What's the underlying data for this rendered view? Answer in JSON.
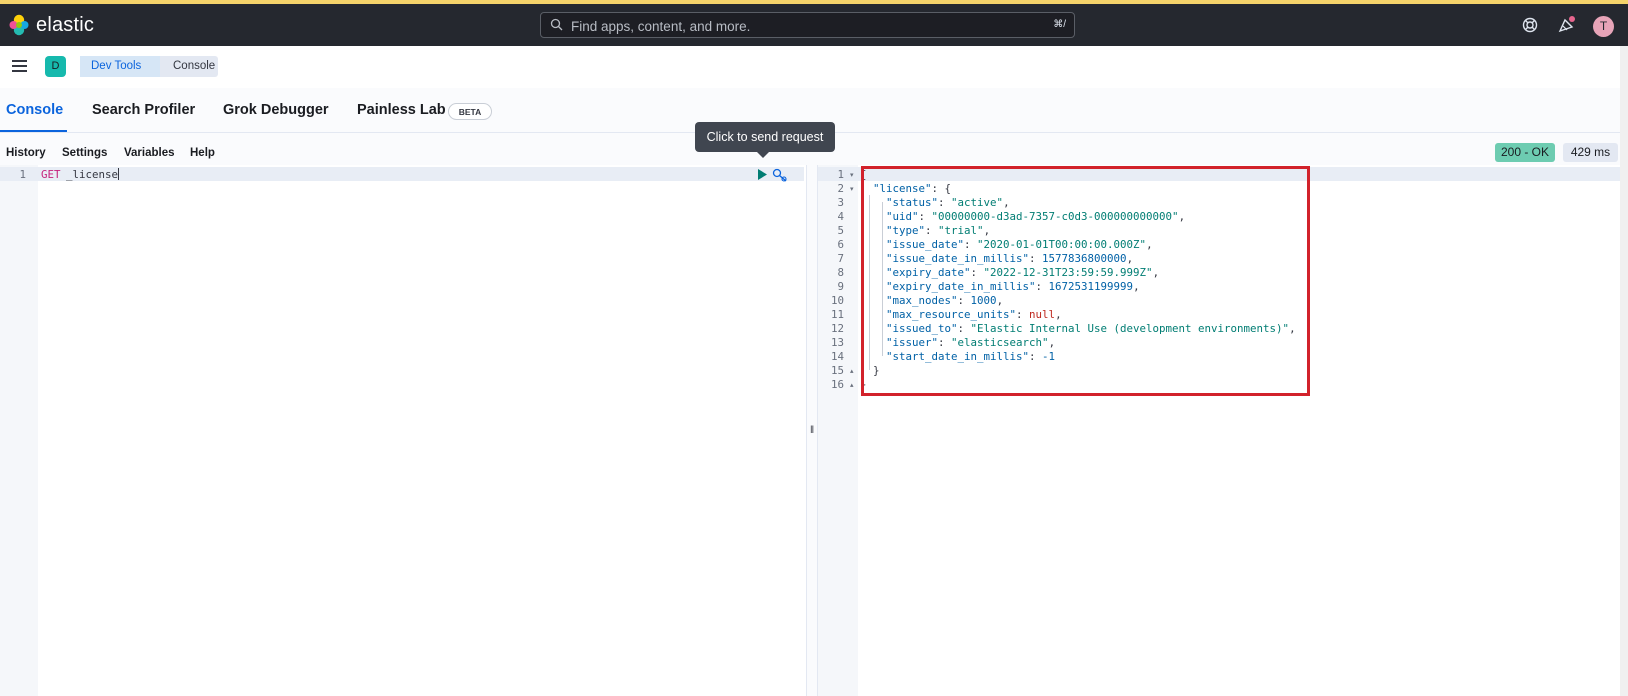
{
  "header": {
    "logo_text": "elastic",
    "search_placeholder": "Find apps, content, and more.",
    "search_shortcut": "⌘/",
    "avatar_initial": "T"
  },
  "breadcrumbs": {
    "space_badge": "D",
    "items": [
      "Dev Tools",
      "Console"
    ]
  },
  "tabs": {
    "items": [
      "Console",
      "Search Profiler",
      "Grok Debugger",
      "Painless Lab"
    ],
    "active": "Console",
    "beta_badge": "BETA"
  },
  "toolbar": {
    "items": [
      "History",
      "Settings",
      "Variables",
      "Help"
    ]
  },
  "status": {
    "code": "200 - OK",
    "time": "429 ms"
  },
  "tooltip": {
    "text": "Click to send request"
  },
  "request_editor": {
    "line_number": "1",
    "method": "GET",
    "path": "_license"
  },
  "response": {
    "line_numbers": [
      "1",
      "2",
      "3",
      "4",
      "5",
      "6",
      "7",
      "8",
      "9",
      "10",
      "11",
      "12",
      "13",
      "14",
      "15",
      "16"
    ],
    "lines": [
      {
        "indent": "",
        "key": "",
        "value": "",
        "raw": "{"
      },
      {
        "indent": "  ",
        "key": "\"license\"",
        "value": "{",
        "raw": ""
      },
      {
        "indent": "    ",
        "key": "\"status\"",
        "value": "\"active\"",
        "raw": ""
      },
      {
        "indent": "    ",
        "key": "\"uid\"",
        "value": "\"00000000-d3ad-7357-c0d3-000000000000\"",
        "raw": ""
      },
      {
        "indent": "    ",
        "key": "\"type\"",
        "value": "\"trial\"",
        "raw": ""
      },
      {
        "indent": "    ",
        "key": "\"issue_date\"",
        "value": "\"2020-01-01T00:00:00.000Z\"",
        "raw": ""
      },
      {
        "indent": "    ",
        "key": "\"issue_date_in_millis\"",
        "value": "1577836800000",
        "raw": ""
      },
      {
        "indent": "    ",
        "key": "\"expiry_date\"",
        "value": "\"2022-12-31T23:59:59.999Z\"",
        "raw": ""
      },
      {
        "indent": "    ",
        "key": "\"expiry_date_in_millis\"",
        "value": "1672531199999",
        "raw": ""
      },
      {
        "indent": "    ",
        "key": "\"max_nodes\"",
        "value": "1000",
        "raw": ""
      },
      {
        "indent": "    ",
        "key": "\"max_resource_units\"",
        "value": "null",
        "raw": ""
      },
      {
        "indent": "    ",
        "key": "\"issued_to\"",
        "value": "\"Elastic Internal Use (development environments)\"",
        "raw": ""
      },
      {
        "indent": "    ",
        "key": "\"issuer\"",
        "value": "\"elasticsearch\"",
        "raw": ""
      },
      {
        "indent": "    ",
        "key": "\"start_date_in_millis\"",
        "value": "-1",
        "raw": ""
      },
      {
        "indent": "  ",
        "key": "",
        "value": "",
        "raw": "}"
      },
      {
        "indent": "",
        "key": "",
        "value": "",
        "raw": "}"
      }
    ]
  },
  "colors": {
    "header_bg": "#25282f",
    "accent": "#0b64dd",
    "status_ok": "#6dccb1",
    "highlight_box": "#d2222b"
  }
}
